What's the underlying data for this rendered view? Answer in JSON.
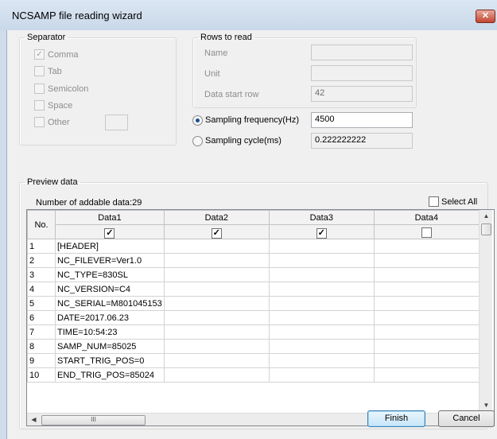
{
  "window": {
    "title": "NCSAMP file reading wizard",
    "close_glyph": "✕"
  },
  "separator": {
    "legend": "Separator",
    "items": [
      {
        "label": "Comma",
        "checked": true
      },
      {
        "label": "Tab",
        "checked": false
      },
      {
        "label": "Semicolon",
        "checked": false
      },
      {
        "label": "Space",
        "checked": false
      },
      {
        "label": "Other",
        "checked": false
      }
    ],
    "other_value": ""
  },
  "rows_to_read": {
    "legend": "Rows to read",
    "name_label": "Name",
    "name_value": "",
    "unit_label": "Unit",
    "unit_value": "",
    "data_start_label": "Data start row",
    "data_start_value": "42"
  },
  "sampling": {
    "frequency_label": "Sampling frequency(Hz)",
    "frequency_value": "4500",
    "frequency_selected": true,
    "cycle_label": "Sampling cycle(ms)",
    "cycle_value": "0.222222222"
  },
  "preview": {
    "legend": "Preview data",
    "addable_text": "Number of addable data:29",
    "select_all_label": "Select All",
    "no_header": "No.",
    "columns": [
      {
        "name": "Data1",
        "checked": true
      },
      {
        "name": "Data2",
        "checked": true
      },
      {
        "name": "Data3",
        "checked": true
      },
      {
        "name": "Data4",
        "checked": false
      }
    ],
    "rows": [
      {
        "no": "1",
        "data1": "[HEADER]"
      },
      {
        "no": "2",
        "data1": "NC_FILEVER=Ver1.0"
      },
      {
        "no": "3",
        "data1": "NC_TYPE=830SL"
      },
      {
        "no": "4",
        "data1": "NC_VERSION=C4"
      },
      {
        "no": "5",
        "data1": "NC_SERIAL=M801045153"
      },
      {
        "no": "6",
        "data1": "DATE=2017.06.23"
      },
      {
        "no": "7",
        "data1": "TIME=10:54:23"
      },
      {
        "no": "8",
        "data1": "SAMP_NUM=85025"
      },
      {
        "no": "9",
        "data1": "START_TRIG_POS=0"
      },
      {
        "no": "10",
        "data1": "END_TRIG_POS=85024"
      }
    ],
    "check_mark": "✓",
    "thumb_grip": "III"
  },
  "buttons": {
    "finish": "Finish",
    "cancel": "Cancel"
  }
}
